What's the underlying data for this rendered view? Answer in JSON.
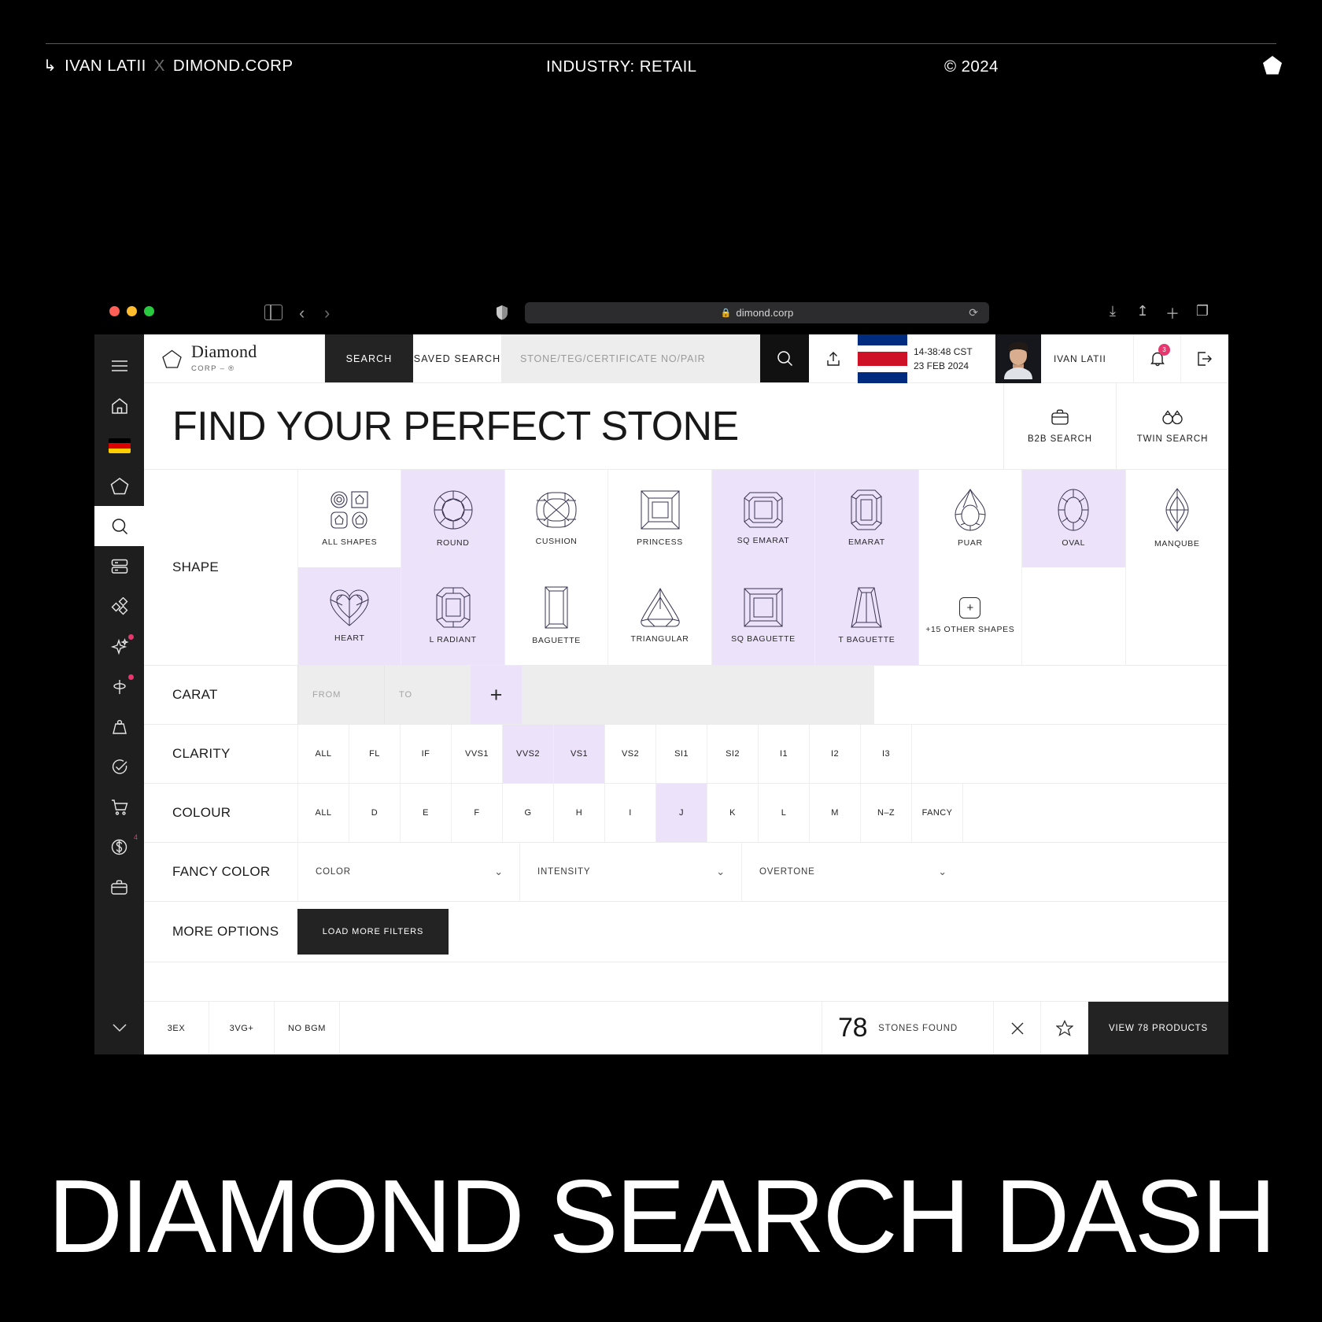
{
  "topbar": {
    "arrow": "↳",
    "author": "IVAN LATII",
    "x": "X",
    "client": "DIMOND.CORP",
    "industry": "INDUSTRY: RETAIL",
    "copyright": "© 2024"
  },
  "browser": {
    "url": "dimond.corp",
    "lock_icon": "lock-icon",
    "reload_icon": "reload-icon",
    "back_icon": "chevron-left-icon",
    "forward_icon": "chevron-right-icon",
    "sidebar_icon": "sidebar-toggle-icon",
    "shield_icon": "shield-icon",
    "right_icons": [
      "download-icon",
      "share-icon",
      "new-tab-icon",
      "tab-overview-icon"
    ]
  },
  "rail": {
    "items": [
      {
        "name": "menu",
        "icon": "hamburger-icon",
        "active": false,
        "badge": ""
      },
      {
        "name": "home",
        "icon": "home-icon",
        "active": false,
        "badge": ""
      },
      {
        "name": "language",
        "icon": "germany-flag-icon",
        "active": false,
        "badge": ""
      },
      {
        "name": "pentagon",
        "icon": "pentagon-icon",
        "active": false,
        "badge": ""
      },
      {
        "name": "search",
        "icon": "search-icon",
        "active": true,
        "badge": ""
      },
      {
        "name": "inventory",
        "icon": "list-icon",
        "active": false,
        "badge": ""
      },
      {
        "name": "diamonds",
        "icon": "diamonds-icon",
        "active": false,
        "badge": ""
      },
      {
        "name": "sparkle",
        "icon": "sparkle-icon",
        "active": false,
        "badge": "dot"
      },
      {
        "name": "location",
        "icon": "pin-icon",
        "active": false,
        "badge": "dot"
      },
      {
        "name": "weight",
        "icon": "weight-icon",
        "active": false,
        "badge": ""
      },
      {
        "name": "approved",
        "icon": "check-circle-icon",
        "active": false,
        "badge": ""
      },
      {
        "name": "cart",
        "icon": "cart-icon",
        "active": false,
        "badge": ""
      },
      {
        "name": "finance",
        "icon": "dollar-circle-icon",
        "active": false,
        "badge": "4"
      },
      {
        "name": "briefcase",
        "icon": "briefcase-icon",
        "active": false,
        "badge": ""
      }
    ],
    "collapse_icon": "chevron-down-icon"
  },
  "appbar": {
    "brand_name": "Diamond",
    "brand_sub": "CORP – ®",
    "brand_icon": "pentagon-logo-icon",
    "tab_search": "SEARCH",
    "tab_saved": "SAVED SEARCH",
    "search_placeholder": "STONE/TEG/CERTIFICATE NO/PAIR",
    "search_value": "",
    "search_icon": "search-icon",
    "upload_icon": "upload-icon",
    "flag_icon": "costa-rica-flag-icon",
    "time": "14-38:48 CST",
    "date": "23 FEB 2024",
    "user_name": "IVAN LATII",
    "avatar_icon": "user-avatar",
    "bell_icon": "bell-icon",
    "bell_badge": "3",
    "logout_icon": "logout-icon"
  },
  "hero": {
    "title": "FIND YOUR PERFECT STONE",
    "actions": [
      {
        "label": "B2B SEARCH",
        "icon": "briefcase-icon"
      },
      {
        "label": "TWIN SEARCH",
        "icon": "twin-rings-icon"
      }
    ]
  },
  "filters": {
    "shape_label": "SHAPE",
    "shapes_row1": [
      {
        "label": "ALL SHAPES",
        "icon": "all-shapes-icon",
        "selected": false
      },
      {
        "label": "ROUND",
        "icon": "round-icon",
        "selected": true
      },
      {
        "label": "CUSHION",
        "icon": "cushion-icon",
        "selected": false
      },
      {
        "label": "PRINCESS",
        "icon": "princess-icon",
        "selected": false
      },
      {
        "label": "SQ EMARAT",
        "icon": "sq-emarat-icon",
        "selected": true
      },
      {
        "label": "EMARAT",
        "icon": "emarat-icon",
        "selected": true
      },
      {
        "label": "PUAR",
        "icon": "pear-icon",
        "selected": false
      },
      {
        "label": "OVAL",
        "icon": "oval-icon",
        "selected": true
      },
      {
        "label": "MANQUBE",
        "icon": "marquise-icon",
        "selected": false
      }
    ],
    "shapes_row2": [
      {
        "label": "HEART",
        "icon": "heart-icon",
        "selected": true
      },
      {
        "label": "L RADIANT",
        "icon": "l-radiant-icon",
        "selected": true
      },
      {
        "label": "BAGUETTE",
        "icon": "baguette-icon",
        "selected": false
      },
      {
        "label": "TRIANGULAR",
        "icon": "triangular-icon",
        "selected": false
      },
      {
        "label": "SQ BAGUETTE",
        "icon": "sq-baguette-icon",
        "selected": true
      },
      {
        "label": "T BAGUETTE",
        "icon": "t-baguette-icon",
        "selected": true
      },
      {
        "label": "+15 OTHER SHAPES",
        "icon": "plus-icon",
        "selected": false
      }
    ],
    "carat_label": "CARAT",
    "carat_from_placeholder": "FROM",
    "carat_from_value": "",
    "carat_to_placeholder": "TO",
    "carat_to_value": "",
    "carat_add_icon": "plus-icon",
    "clarity_label": "CLARITY",
    "clarity": [
      {
        "label": "ALL",
        "selected": false
      },
      {
        "label": "FL",
        "selected": false
      },
      {
        "label": "IF",
        "selected": false
      },
      {
        "label": "VVS1",
        "selected": false
      },
      {
        "label": "VVS2",
        "selected": true
      },
      {
        "label": "VS1",
        "selected": true
      },
      {
        "label": "VS2",
        "selected": false
      },
      {
        "label": "SI1",
        "selected": false
      },
      {
        "label": "SI2",
        "selected": false
      },
      {
        "label": "I1",
        "selected": false
      },
      {
        "label": "I2",
        "selected": false
      },
      {
        "label": "I3",
        "selected": false
      }
    ],
    "colour_label": "COLOUR",
    "colour": [
      {
        "label": "ALL",
        "selected": false
      },
      {
        "label": "D",
        "selected": false
      },
      {
        "label": "E",
        "selected": false
      },
      {
        "label": "F",
        "selected": false
      },
      {
        "label": "G",
        "selected": false
      },
      {
        "label": "H",
        "selected": false
      },
      {
        "label": "I",
        "selected": false
      },
      {
        "label": "J",
        "selected": true
      },
      {
        "label": "K",
        "selected": false
      },
      {
        "label": "L",
        "selected": false
      },
      {
        "label": "M",
        "selected": false
      },
      {
        "label": "N–Z",
        "selected": false
      },
      {
        "label": "FANCY",
        "selected": false
      }
    ],
    "fancy_label": "FANCY COLOR",
    "fancy_selects": [
      {
        "label": "COLOR",
        "icon": "chevron-down-icon"
      },
      {
        "label": "INTENSITY",
        "icon": "chevron-down-icon"
      },
      {
        "label": "OVERTONE",
        "icon": "chevron-down-icon"
      }
    ],
    "more_label": "MORE OPTIONS",
    "load_more": "LOAD MORE FILTERS"
  },
  "footer": {
    "chips": [
      "3EX",
      "3VG+",
      "NO BGM"
    ],
    "count": "78",
    "count_label": "STONES FOUND",
    "clear_icon": "close-icon",
    "save_icon": "star-icon",
    "view_button": "VIEW 78 PRODUCTS"
  },
  "caption": "DIAMOND SEARCH DASH",
  "colors": {
    "selected": "#ece3fb",
    "dark": "#232323",
    "badge": "#e8366e"
  }
}
